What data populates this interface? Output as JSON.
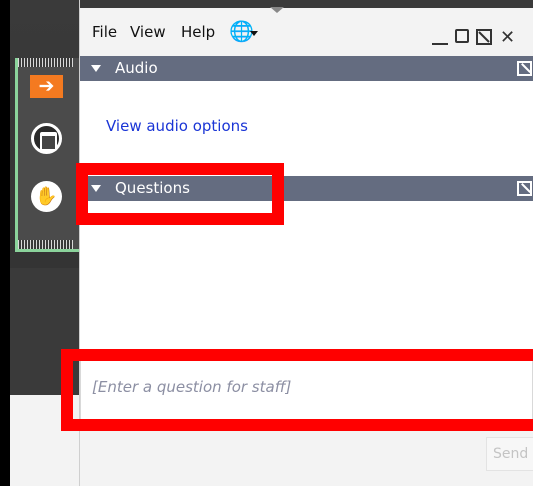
{
  "menubar": {
    "file": "File",
    "view": "View",
    "help": "Help",
    "globe_icon": "globe-icon"
  },
  "window_controls": {
    "minimize_icon": "minimize-icon",
    "maximize_icon": "maximize-icon",
    "restore_icon": "restore-icon",
    "close_glyph": "✕"
  },
  "grab_tab": {
    "collapse_glyph": "➔",
    "collapse_color": "#f47a20",
    "dashboard_icon": "window-icon",
    "raise_hand_icon": "raise-hand-icon",
    "hand_glyph": "✋",
    "accent_color": "#8bd39b"
  },
  "audio": {
    "title": "Audio",
    "link": "View audio options"
  },
  "questions": {
    "title": "Questions",
    "placeholder": "[Enter a question for staff]",
    "send": "Send"
  },
  "colors": {
    "section_header": "#646c80",
    "link": "#1a35d6",
    "highlight": "#ff0000"
  }
}
